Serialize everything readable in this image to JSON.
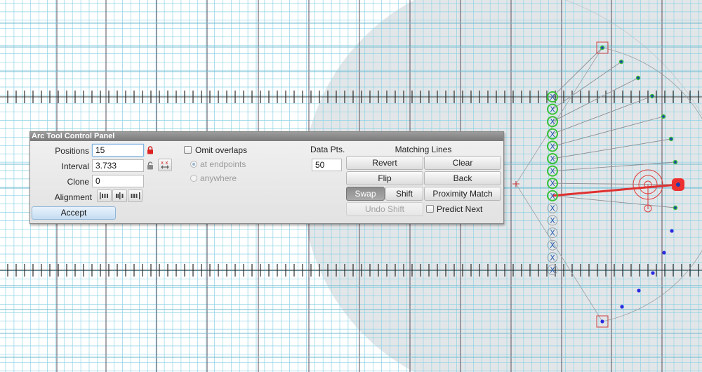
{
  "panel": {
    "title": "Arc Tool Control Panel",
    "positions": {
      "label": "Positions",
      "value": "15"
    },
    "interval": {
      "label": "Interval",
      "value": "3.733"
    },
    "clone": {
      "label": "Clone",
      "value": "0"
    },
    "alignment": {
      "label": "Alignment",
      "options": [
        "left-align-icon",
        "center-align-icon",
        "right-align-icon"
      ]
    },
    "accept_label": "Accept",
    "omit_overlaps": {
      "label": "Omit overlaps",
      "checked": false
    },
    "radio_endpoints": {
      "label": "at endpoints",
      "selected": true,
      "disabled": true
    },
    "radio_anywhere": {
      "label": "anywhere",
      "selected": false,
      "disabled": true
    },
    "data_pts": {
      "label": "Data Pts.",
      "value": "50"
    },
    "matching_lines": {
      "label": "Matching Lines",
      "revert": "Revert",
      "clear": "Clear",
      "flip": "Flip",
      "back": "Back",
      "swap": "Swap",
      "shift": "Shift",
      "proximity_match": "Proximity Match",
      "undo_shift": "Undo Shift"
    },
    "predict_next": {
      "label": "Predict Next",
      "checked": false
    }
  },
  "colors": {
    "grid_minor": "#8fd3e6",
    "grid_major": "#5a4f5c",
    "region": "#e3e6e8",
    "active_marker": "#39c239",
    "inactive_marker": "#2b5fb0",
    "selection": "#e03030",
    "arc_point_green": "#3fbf3f",
    "arc_point_blue": "#2a2ae0"
  }
}
